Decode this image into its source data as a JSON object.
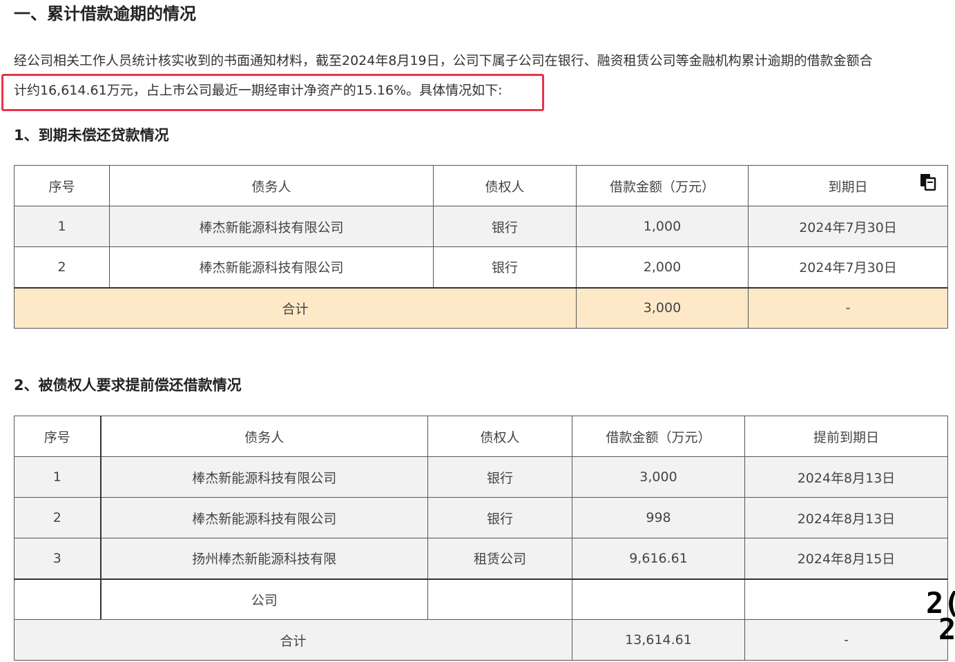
{
  "title": "一、累计借款逾期的情况",
  "intro_line1": "经公司相关工作人员统计核实收到的书面通知材料，截至2024年8月19日，公司下属子公司在银行、融资租赁公司等金融机构累计逾期的借款金额合",
  "intro_line2": "计约16,614.61万元，占上市公司最近一期经审计净资产的15.16%。具体情况如下:",
  "section1": {
    "heading": "1、到期未偿还贷款情况",
    "headers": [
      "序号",
      "债务人",
      "债权人",
      "借款金额（万元）",
      "到期日"
    ],
    "rows": [
      {
        "no": "1",
        "debtor": "棒杰新能源科技有限公司",
        "creditor": "银行",
        "amount": "1,000",
        "date": "2024年7月30日"
      },
      {
        "no": "2",
        "debtor": "棒杰新能源科技有限公司",
        "creditor": "银行",
        "amount": "2,000",
        "date": "2024年7月30日"
      }
    ],
    "total": {
      "label": "合计",
      "amount": "3,000",
      "date": "-"
    }
  },
  "section2": {
    "heading": "2、被债权人要求提前偿还借款情况",
    "headers": [
      "序号",
      "债务人",
      "债权人",
      "借款金额（万元）",
      "提前到期日"
    ],
    "rows": [
      {
        "no": "1",
        "debtor": "棒杰新能源科技有限公司",
        "creditor": "银行",
        "amount": "3,000",
        "date": "2024年8月13日"
      },
      {
        "no": "2",
        "debtor": "棒杰新能源科技有限公司",
        "creditor": "银行",
        "amount": "998",
        "date": "2024年8月13日"
      },
      {
        "no": "3",
        "debtor": "扬州棒杰新能源科技有限",
        "creditor": "租赁公司",
        "amount": "9,616.61",
        "date": "2024年8月15日"
      }
    ],
    "continuation": {
      "debtor": "公司"
    },
    "total": {
      "label": "合计",
      "amount": "13,614.61",
      "date": "-"
    }
  },
  "stray_text": [
    "2(",
    "2"
  ],
  "icons": {
    "copy": "copy-icon"
  },
  "colors": {
    "highlight_border": "#e8334a",
    "total_row_bg": "#fde8c7",
    "alt_row_bg": "#f2f2f2"
  }
}
